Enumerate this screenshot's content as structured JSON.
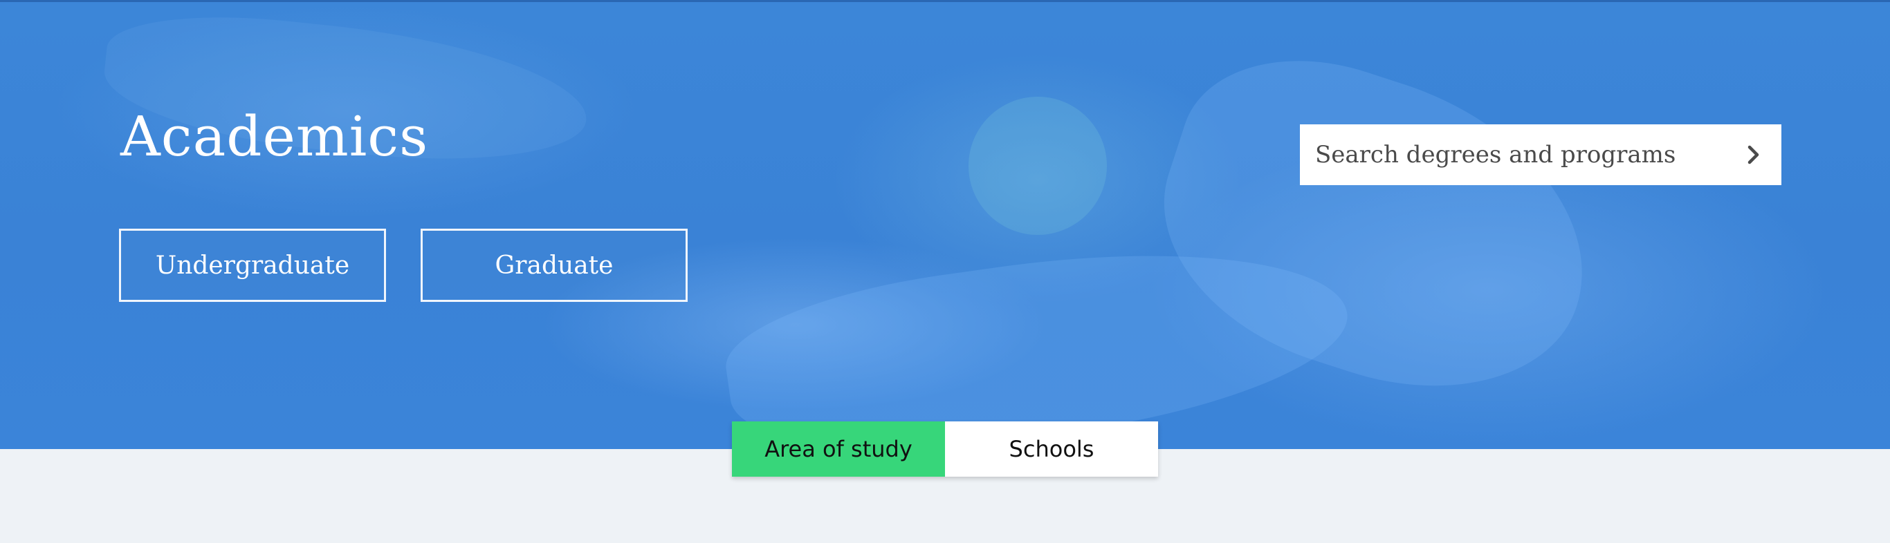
{
  "hero": {
    "title": "Academics",
    "buttons": {
      "undergraduate": "Undergraduate",
      "graduate": "Graduate"
    },
    "search": {
      "placeholder": "Search degrees and programs",
      "submit_icon": "chevron-right-icon"
    }
  },
  "tabs": {
    "area_of_study": "Area of study",
    "schools": "Schools",
    "active": "Area of study"
  },
  "colors": {
    "hero_blue": "#3c86d8",
    "active_tab": "#37d67a",
    "page_background": "#eef2f6"
  }
}
